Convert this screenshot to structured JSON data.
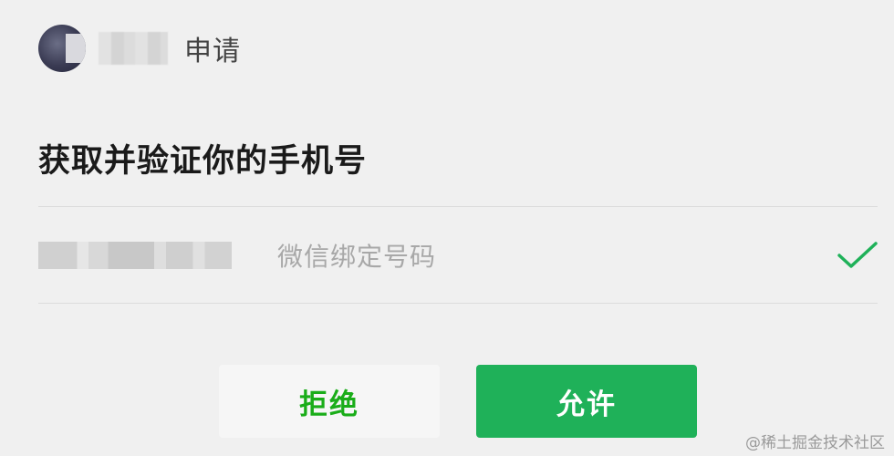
{
  "header": {
    "request_label": "申请"
  },
  "title": "获取并验证你的手机号",
  "phone_row": {
    "label": "微信绑定号码",
    "selected_icon": "check-icon"
  },
  "buttons": {
    "deny_label": "拒绝",
    "allow_label": "允许"
  },
  "watermark": "@稀土掘金技术社区",
  "colors": {
    "accent_green": "#1fb159",
    "deny_text_green": "#1aad19",
    "background": "#f0f0f0"
  }
}
